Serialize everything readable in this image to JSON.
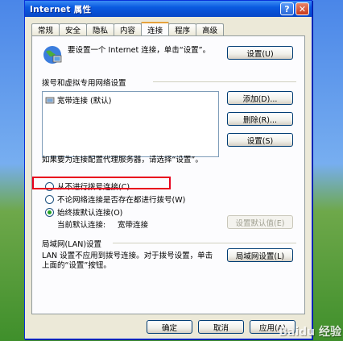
{
  "window": {
    "title": "Internet 属性"
  },
  "titlebar": {
    "help": "?",
    "close": "✕"
  },
  "tabs": [
    {
      "label": "常规"
    },
    {
      "label": "安全"
    },
    {
      "label": "隐私"
    },
    {
      "label": "内容"
    },
    {
      "label": "连接",
      "active": true
    },
    {
      "label": "程序"
    },
    {
      "label": "高级"
    }
  ],
  "setup": {
    "text": "要设置一个 Internet 连接，单击“设置”。",
    "button": "设置(U)"
  },
  "dialup": {
    "heading": "拨号和虚拟专用网络设置",
    "list": [
      {
        "label": "宽带连接 (默认)"
      }
    ],
    "add_button": "添加(D)...",
    "remove_button": "删除(R)...",
    "settings_button": "设置(S)"
  },
  "proxy_note": "如果要为连接配置代理服务器，请选择“设置”。",
  "dial_options": {
    "selected": "always",
    "never": "从不进行拨号连接(C)",
    "when_no_network": "不论网络连接是否存在都进行拨号(W)",
    "always": "始终拨默认连接(O)",
    "current_default_label": "当前默认连接:",
    "current_default_value": "宽带连接",
    "set_default_button": "设置默认值(E)"
  },
  "lan": {
    "heading": "局域网(LAN)设置",
    "text": "LAN 设置不应用到拨号连接。对于拨号设置，单击上面的“设置”按钮。",
    "button": "局域网设置(L)"
  },
  "footer": {
    "ok": "确定",
    "cancel": "取消",
    "apply": "应用(A)"
  },
  "watermark": "Baidu 经验"
}
